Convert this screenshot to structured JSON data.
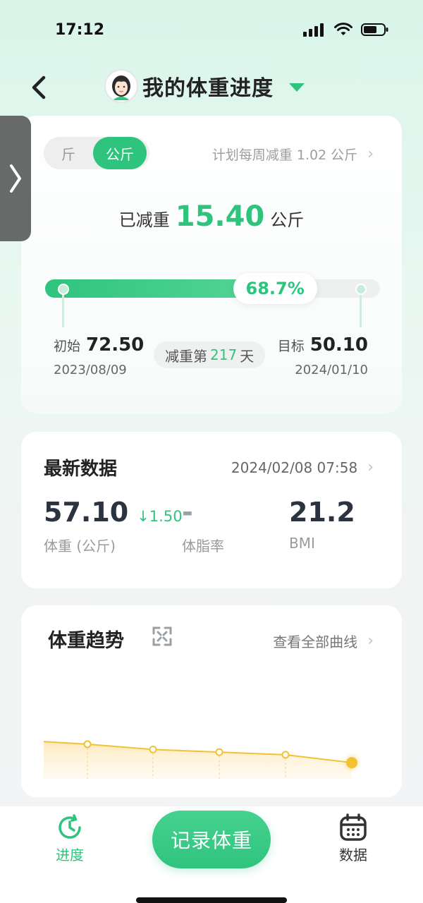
{
  "status_bar": {
    "time": "17:12"
  },
  "header": {
    "title": "我的体重进度"
  },
  "unit_toggle": {
    "options": [
      "斤",
      "公斤"
    ],
    "selected": "公斤"
  },
  "plan": {
    "text": "计划每周减重 1.02 公斤"
  },
  "lost": {
    "label": "已减重",
    "value": "15.40",
    "unit": "公斤"
  },
  "progress": {
    "percent_text": "68.7%",
    "fraction": 0.687
  },
  "start": {
    "label": "初始",
    "value": "72.50",
    "date": "2023/08/09"
  },
  "goal": {
    "label": "目标",
    "value": "50.10",
    "date": "2024/01/10"
  },
  "days": {
    "prefix": "减重第",
    "count": "217",
    "suffix": "天"
  },
  "latest": {
    "title": "最新数据",
    "datetime": "2024/02/08 07:58",
    "weight": {
      "value": "57.10",
      "diff": "↓1.50",
      "label": "体重 (公斤)"
    },
    "body_fat": {
      "value": "-",
      "label": "体脂率"
    },
    "bmi": {
      "value": "21.2",
      "label": "BMI"
    }
  },
  "trend": {
    "title": "体重趋势",
    "view_all": "查看全部曲线"
  },
  "chart_data": {
    "type": "line",
    "series": [
      {
        "values": [
          57.6,
          57.5,
          57.3,
          57.2,
          57.1,
          56.8
        ]
      }
    ],
    "points_marked": [
      1,
      2,
      3,
      4,
      5
    ],
    "color": "#f2c230"
  },
  "bottom_nav": {
    "progress_label": "进度",
    "record_label": "记录体重",
    "data_label": "数据"
  },
  "colors": {
    "accent": "#2fc47e",
    "chart_line": "#f2c230"
  }
}
